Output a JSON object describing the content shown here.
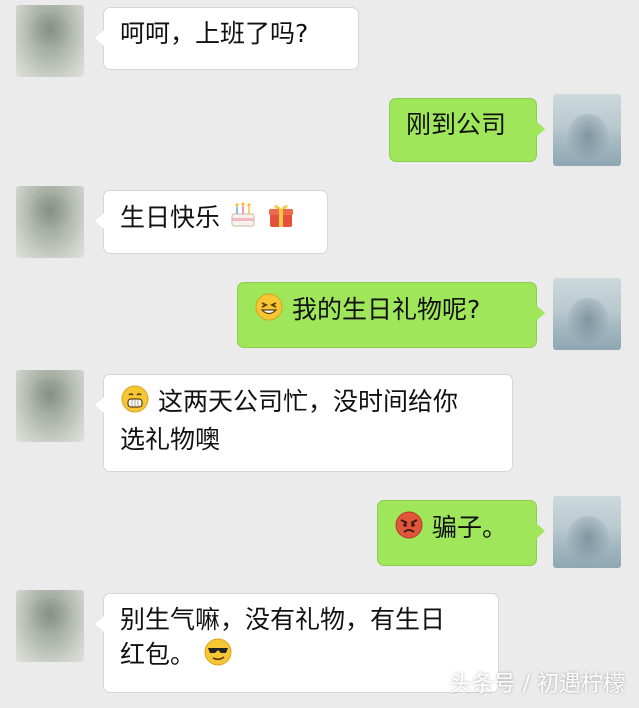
{
  "chat": {
    "messages": [
      {
        "side": "left",
        "text": "呵呵，上班了吗?"
      },
      {
        "side": "right",
        "text": "刚到公司"
      },
      {
        "side": "left",
        "text": "生日快乐",
        "emojis": [
          "cake-emoji",
          "gift-emoji"
        ]
      },
      {
        "side": "right",
        "text": "我的生日礼物呢?",
        "emojis": [
          "grin-squint-emoji"
        ]
      },
      {
        "side": "left",
        "line1": "这两天公司忙，没时间给你",
        "line2": "选礼物噢",
        "emojis": [
          "grinning-emoji"
        ]
      },
      {
        "side": "right",
        "text": "骗子。",
        "emojis": [
          "angry-emoji"
        ]
      },
      {
        "side": "left",
        "line1": "别生气嘛，没有礼物，有生日",
        "line2": "红包。",
        "emojis": [
          "sunglasses-emoji"
        ]
      }
    ]
  },
  "watermark": "头条号 / 初遇柠檬",
  "colors": {
    "background": "#ebebeb",
    "left_bubble": "#ffffff",
    "right_bubble": "#9fe65b"
  }
}
